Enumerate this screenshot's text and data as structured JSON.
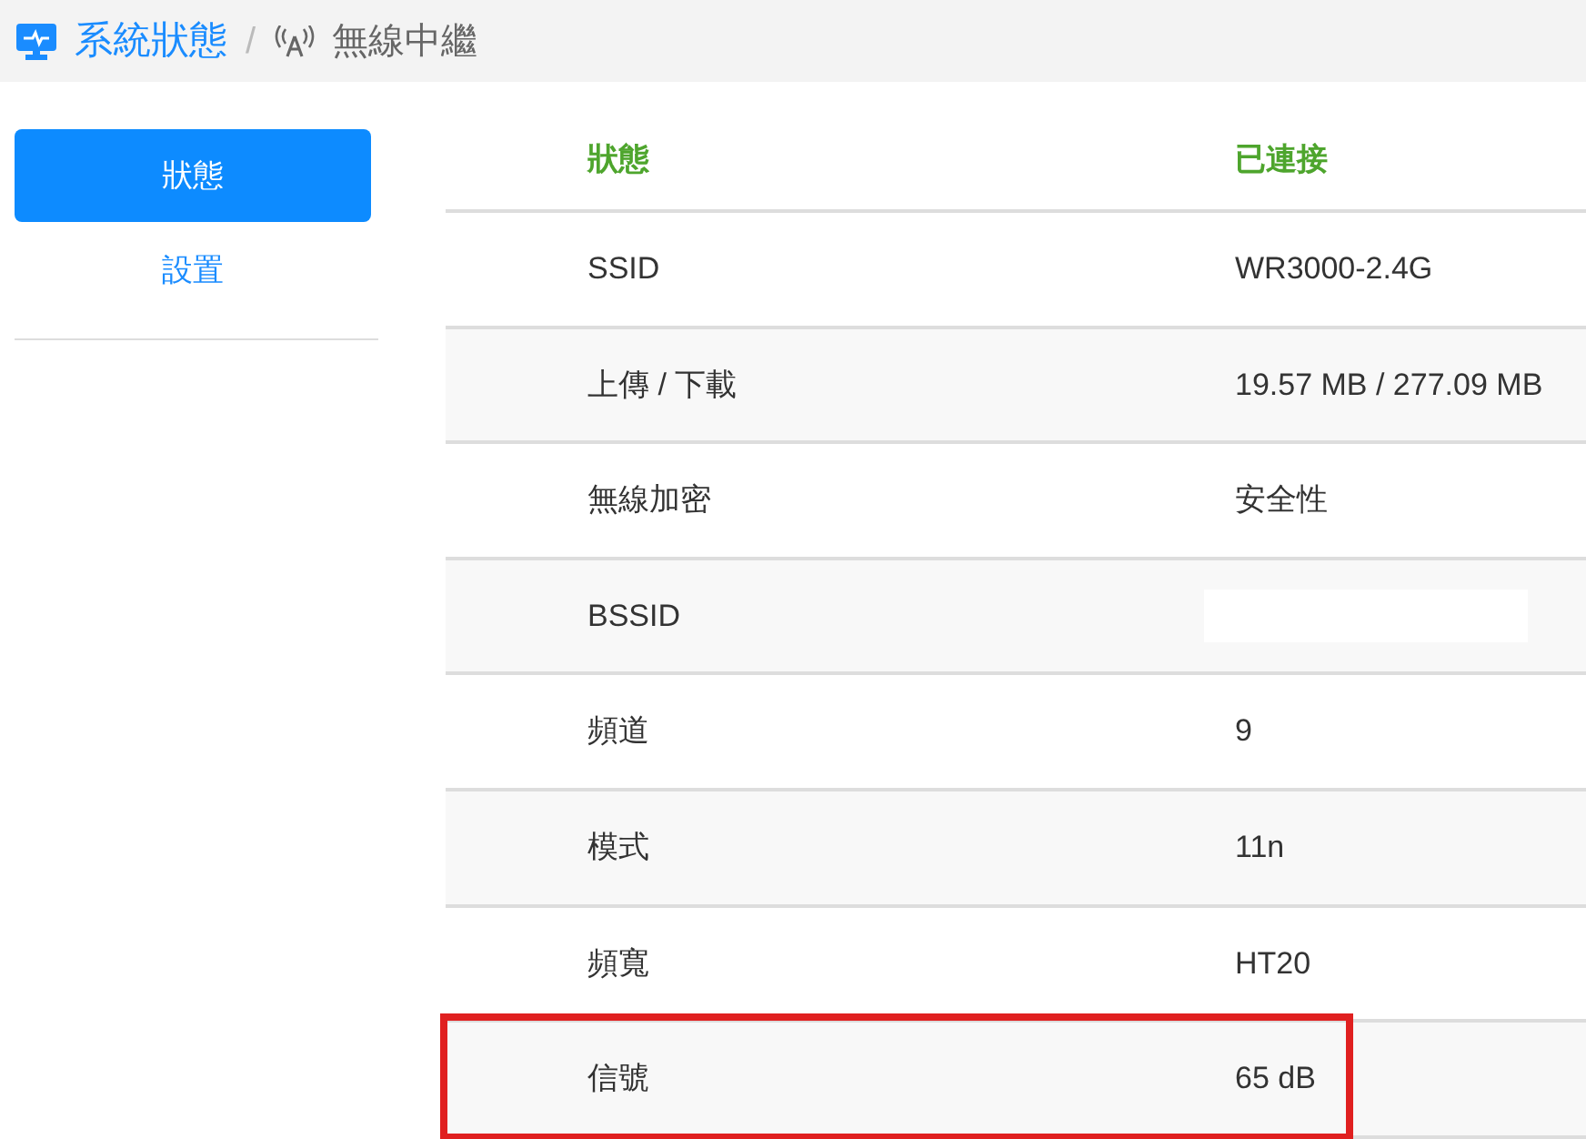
{
  "breadcrumb": {
    "section": "系統狀態",
    "separator": "/",
    "page": "無線中繼"
  },
  "sidebar": {
    "items": [
      {
        "label": "狀態",
        "selected": true
      },
      {
        "label": "設置",
        "selected": false
      }
    ]
  },
  "table": {
    "rows": [
      {
        "kind": "header",
        "label": "狀態",
        "value": "已連接",
        "highlighted": false
      },
      {
        "kind": "data",
        "label": "SSID",
        "value": "WR3000-2.4G",
        "highlighted": false
      },
      {
        "kind": "data",
        "label": "上傳 / 下載",
        "value": "19.57 MB / 277.09 MB",
        "highlighted": false
      },
      {
        "kind": "data",
        "label": "無線加密",
        "value": "安全性",
        "highlighted": false
      },
      {
        "kind": "data",
        "label": "BSSID",
        "redacted": true,
        "highlighted": false
      },
      {
        "kind": "data",
        "label": "頻道",
        "value": "9",
        "highlighted": false
      },
      {
        "kind": "data",
        "label": "模式",
        "value": "11n",
        "highlighted": false
      },
      {
        "kind": "data",
        "label": "頻寬",
        "value": "HT20",
        "highlighted": false
      },
      {
        "kind": "data",
        "label": "信號",
        "value": "65 dB",
        "highlighted": true
      }
    ]
  }
}
